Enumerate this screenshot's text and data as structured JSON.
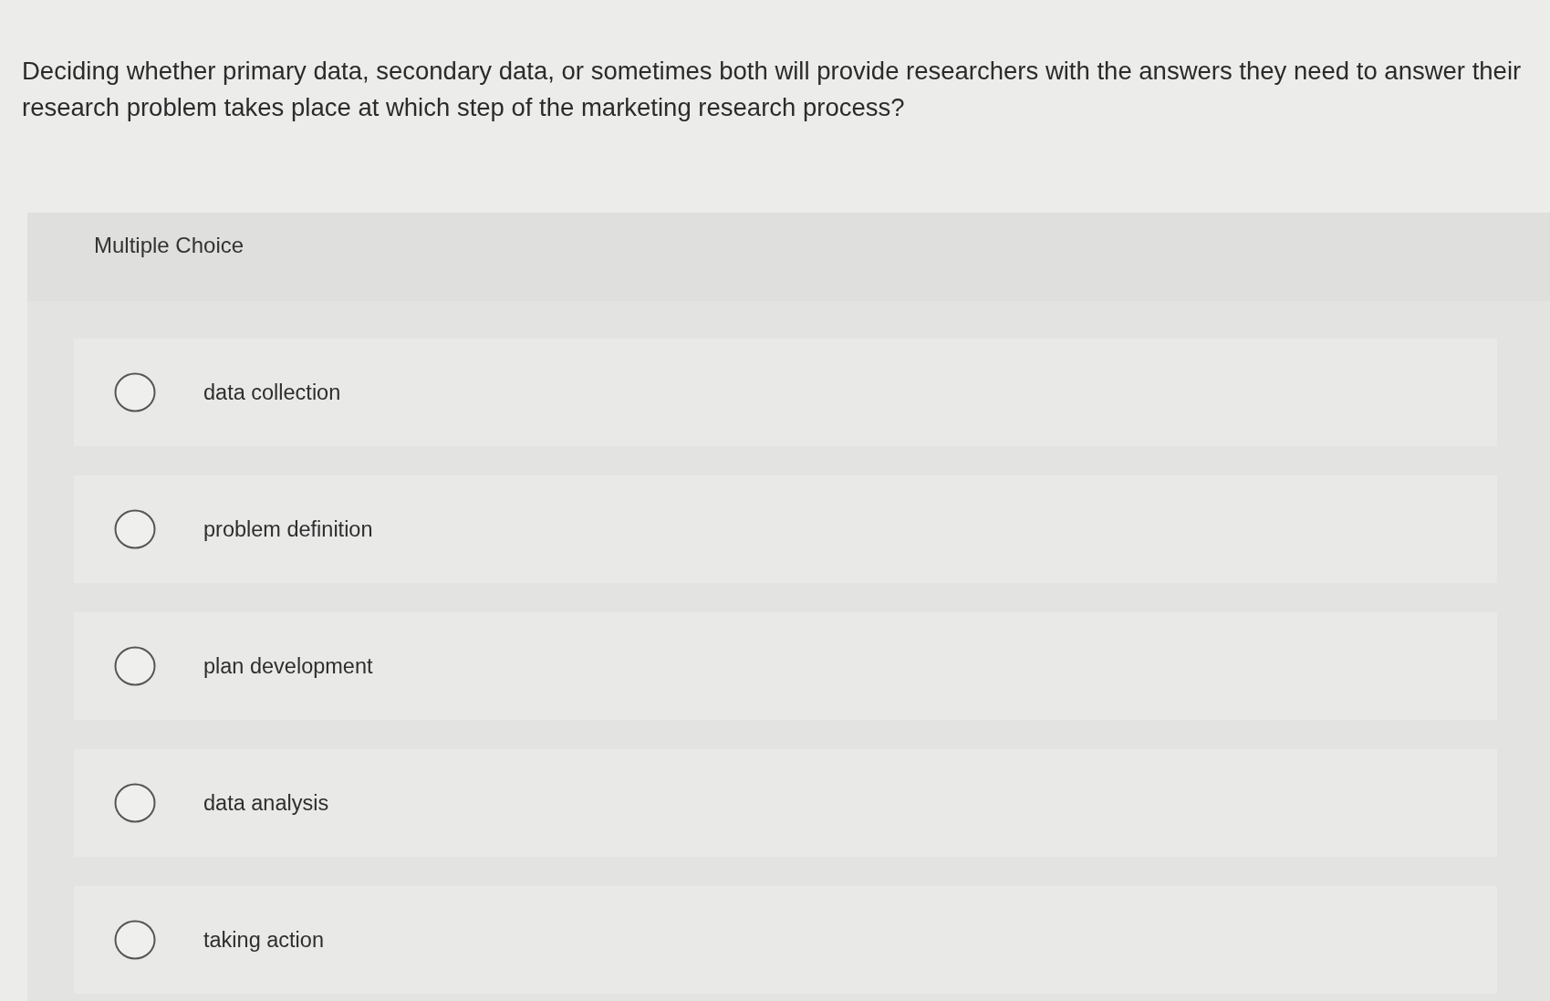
{
  "question": "Deciding whether primary data, secondary data, or sometimes both will provide researchers with the answers they need to answer their research problem takes place at which step of the marketing research process?",
  "panel": {
    "title": "Multiple Choice"
  },
  "options": [
    {
      "label": "data collection",
      "selected": false
    },
    {
      "label": "problem definition",
      "selected": false
    },
    {
      "label": "plan development",
      "selected": false
    },
    {
      "label": "data analysis",
      "selected": false
    },
    {
      "label": "taking action",
      "selected": false
    }
  ]
}
